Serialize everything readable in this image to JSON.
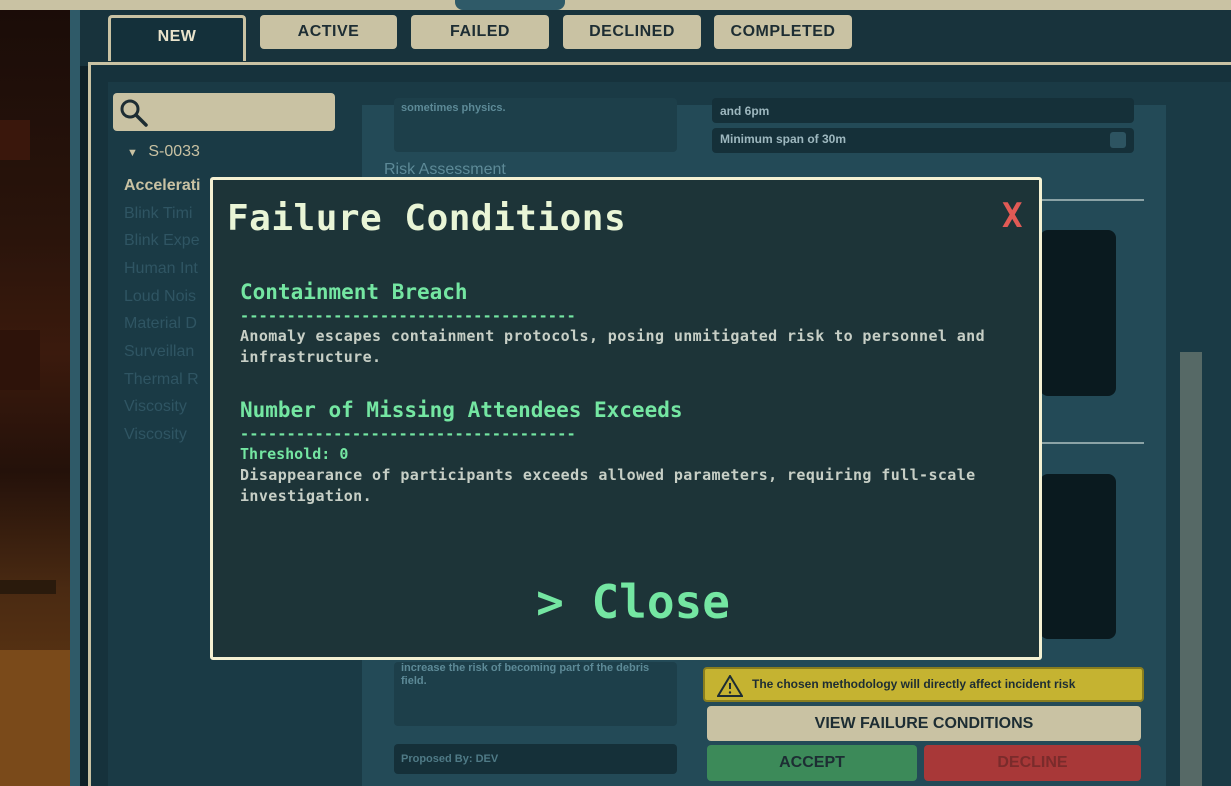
{
  "tabs": [
    {
      "label": "NEW",
      "active": true
    },
    {
      "label": "ACTIVE",
      "active": false
    },
    {
      "label": "FAILED",
      "active": false
    },
    {
      "label": "DECLINED",
      "active": false
    },
    {
      "label": "COMPLETED",
      "active": false
    }
  ],
  "sidebar": {
    "search_icon": "search-icon",
    "group": {
      "chevron": "▼",
      "label": "S-0033"
    },
    "items": [
      {
        "label": "Accelerati",
        "selected": true
      },
      {
        "label": "Blink Timi",
        "selected": false
      },
      {
        "label": "Blink Expe",
        "selected": false
      },
      {
        "label": "Human Int",
        "selected": false
      },
      {
        "label": "Loud Nois",
        "selected": false
      },
      {
        "label": "Material D",
        "selected": false
      },
      {
        "label": "Surveillan",
        "selected": false
      },
      {
        "label": "Thermal R",
        "selected": false
      },
      {
        "label": "Viscosity",
        "selected": false
      },
      {
        "label": "Viscosity",
        "selected": false
      }
    ]
  },
  "detail": {
    "snippet_top": "sometimes physics.",
    "constraint_1": "and 6pm",
    "constraint_2": "Minimum span of 30m",
    "risk_heading": "Risk Assessment",
    "snippet_bottom": "increase the risk of becoming part of the debris field.",
    "proposed_by": "Proposed By: DEV",
    "warning_text": "The chosen methodology will directly affect incident risk",
    "view_failure_label": "VIEW FAILURE CONDITIONS",
    "accept_label": "ACCEPT",
    "decline_label": "DECLINE"
  },
  "modal": {
    "title": "Failure Conditions",
    "close_x": "X",
    "conditions": [
      {
        "name": "Containment Breach",
        "dashes": "------------------------------------",
        "threshold": "",
        "description": "Anomaly escapes containment protocols, posing unmitigated risk to personnel and infrastructure."
      },
      {
        "name": "Number of Missing Attendees Exceeds",
        "dashes": "------------------------------------",
        "threshold": "Threshold: 0",
        "description": "Disappearance of participants exceeds allowed parameters, requiring full-scale investigation."
      }
    ],
    "close_button": "> Close"
  },
  "colors": {
    "accent_green": "#74e6a2",
    "close_red": "#e15a55",
    "tab_beige": "#c9c2a3",
    "warning_yellow": "#c5b331",
    "accept_green": "#3c8a59",
    "decline_red": "#a83838"
  }
}
